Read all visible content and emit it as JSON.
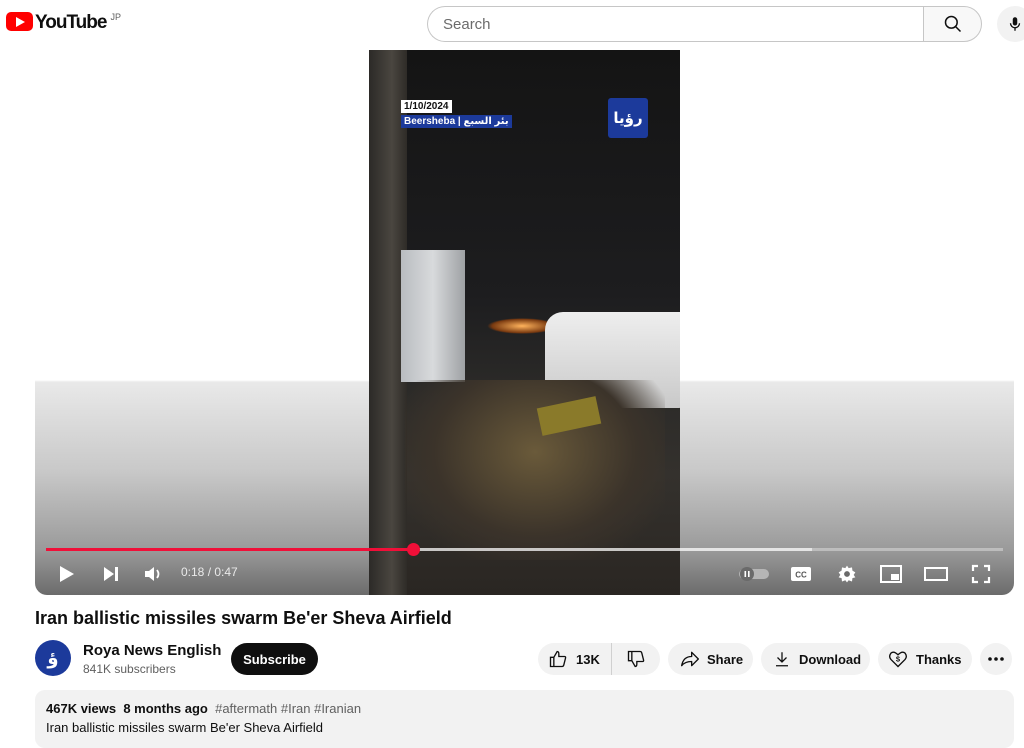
{
  "header": {
    "logo_text": "YouTube",
    "region": "JP",
    "search_placeholder": "Search",
    "icons": [
      "youtube-logo-icon",
      "search-icon",
      "mic-icon"
    ]
  },
  "player": {
    "overlay_date": "1/10/2024",
    "overlay_location": "Beersheba | بئر السبع",
    "channel_bug": "رؤيا",
    "time": "0:18 / 0:47",
    "played_fraction": 0.383,
    "buffered_fraction": 0.8,
    "accent_color": "#f00f38",
    "icons": [
      "play-icon",
      "next-icon",
      "volume-icon",
      "autoplay-toggle-icon",
      "captions-icon",
      "settings-icon",
      "miniplayer-icon",
      "theater-icon",
      "fullscreen-icon"
    ]
  },
  "video": {
    "title": "Iran ballistic missiles swarm Be'er Sheva Airfield"
  },
  "channel": {
    "name": "Roya News English",
    "subscribers": "841K subscribers",
    "subscribe_label": "Subscribe",
    "avatar_letter": "ؤ",
    "avatar_color": "#1c3a9b"
  },
  "actions": {
    "likes": "13K",
    "share": "Share",
    "download": "Download",
    "thanks": "Thanks"
  },
  "description": {
    "views": "467K views",
    "age": "8 months ago",
    "tags": "#aftermath #Iran #Iranian",
    "text": "Iran ballistic missiles swarm Be'er Sheva Airfield"
  }
}
